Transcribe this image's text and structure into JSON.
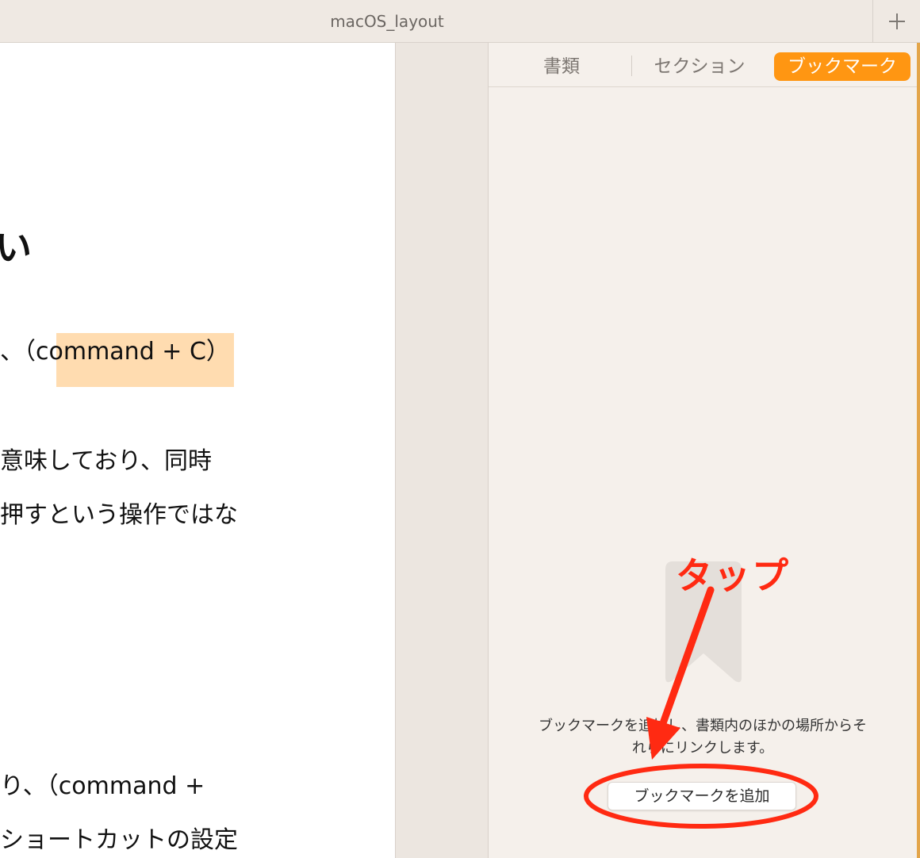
{
  "window": {
    "title": "macOS_layout",
    "add_tab_icon": "plus-icon"
  },
  "document": {
    "lines": [
      "い",
      "、（command + C）",
      "意味しており、同時",
      "押すという操作ではな",
      "り、（command +",
      "ショートカットの設定"
    ]
  },
  "sidebar": {
    "tabs": [
      {
        "label": "書類",
        "active": false
      },
      {
        "label": "セクション",
        "active": false
      },
      {
        "label": "ブックマーク",
        "active": true
      }
    ],
    "empty_icon": "bookmark-icon",
    "hint_line1": "ブックマークを追加し、書類内のほかの場所からそ",
    "hint_line2": "れらにリンクします。",
    "add_button_label": "ブックマークを追加"
  },
  "annotation": {
    "label": "タップ",
    "color": "#ff2a12"
  },
  "colors": {
    "accent": "#ff9612",
    "highlight": "#ffdcb0",
    "annotation": "#ff2a12"
  }
}
